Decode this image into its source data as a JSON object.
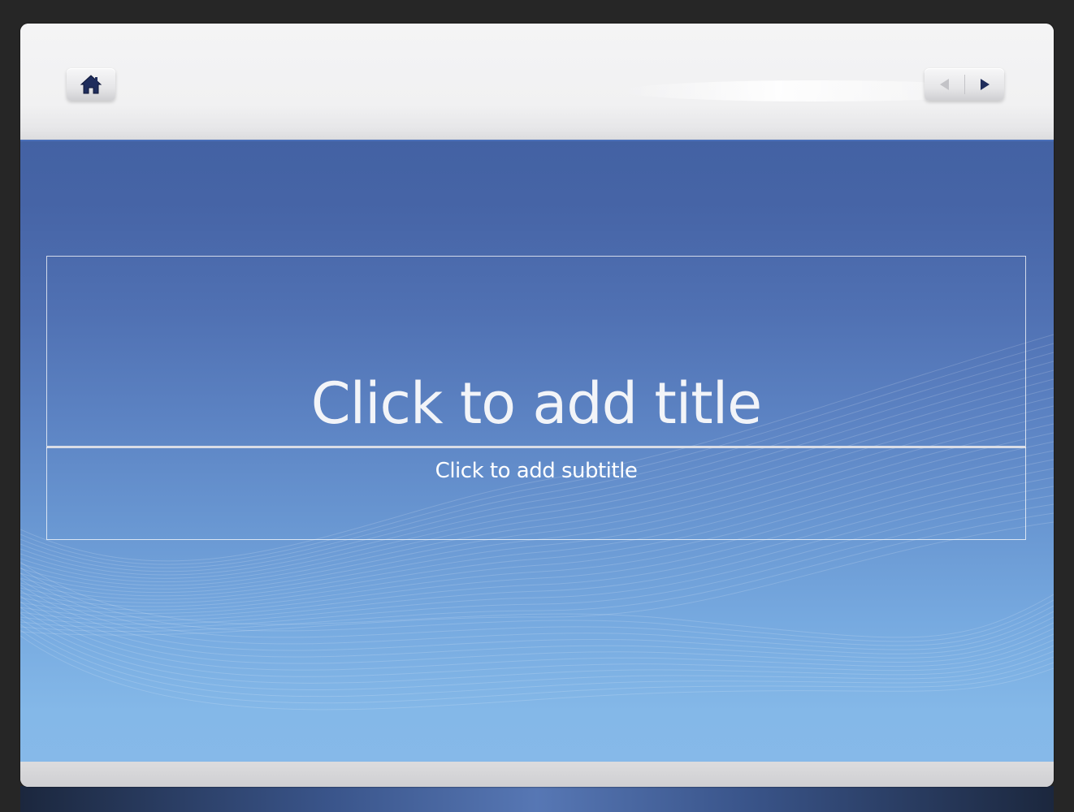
{
  "slide": {
    "title_placeholder": "Click to add title",
    "subtitle_placeholder": "Click to add subtitle"
  },
  "navigation": {
    "home_icon": "home-icon",
    "previous_icon": "triangle-left-icon",
    "next_icon": "triangle-right-icon"
  },
  "colors": {
    "header": "#f2f2f3",
    "body_top": "#4362a3",
    "body_bottom": "#86b9e9",
    "icon": "#1f2d5c"
  }
}
